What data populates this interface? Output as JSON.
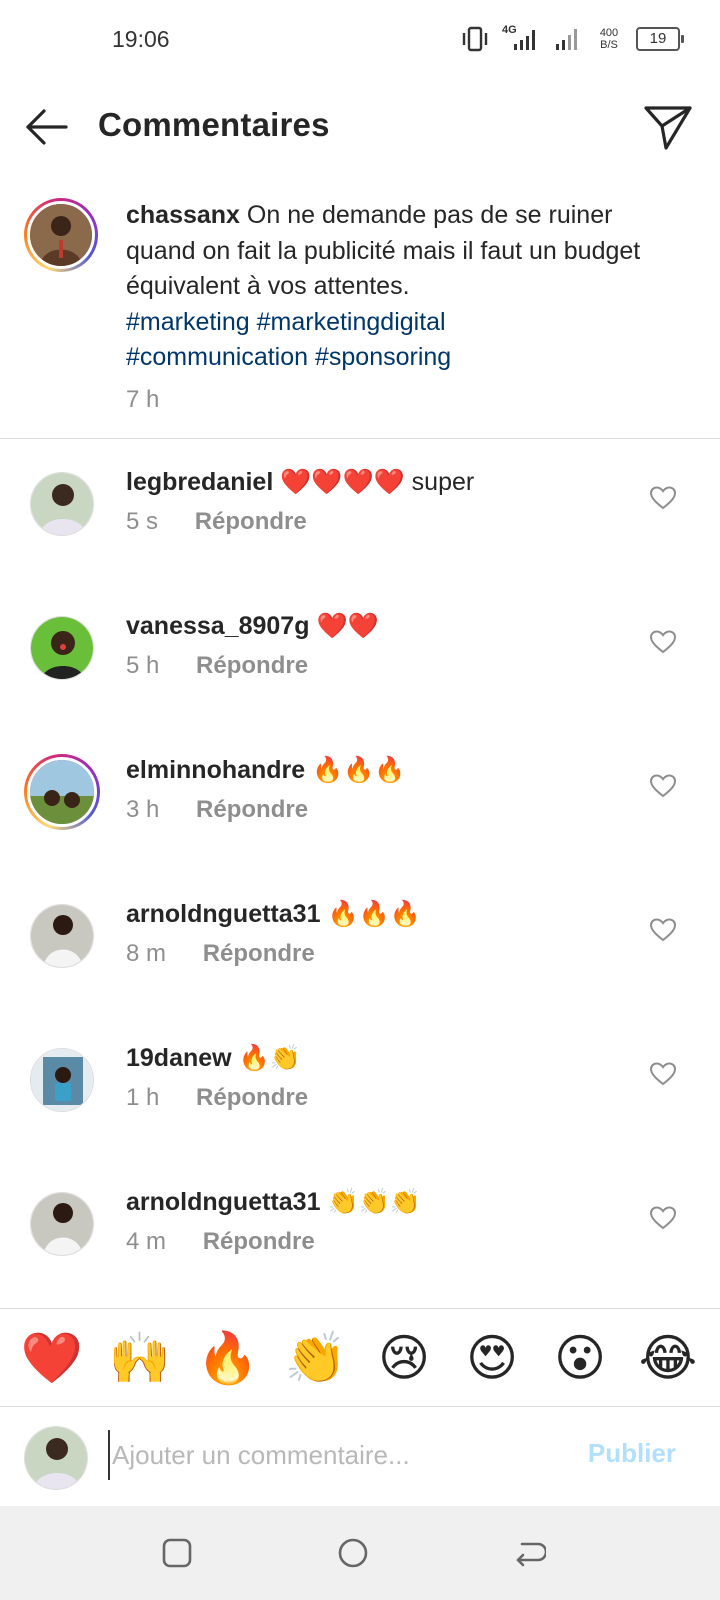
{
  "status_bar": {
    "time": "19:06",
    "network": "4G",
    "speed_top": "400",
    "speed_bottom": "B/S",
    "battery": "19"
  },
  "header": {
    "title": "Commentaires"
  },
  "caption": {
    "username": "chassanx",
    "text": "On ne demande pas de se ruiner quand on fait la publicité mais il faut un budget équivalent à vos attentes.",
    "hashtags": [
      "#marketing",
      "#marketingdigital",
      "#communication",
      "#sponsoring"
    ],
    "time": "7 h"
  },
  "comments": [
    {
      "username": "legbredaniel",
      "text": "❤️❤️❤️❤️ super",
      "time": "5 s",
      "reply": "Répondre"
    },
    {
      "username": "vanessa_8907g",
      "text": "❤️❤️",
      "time": "5 h",
      "reply": "Répondre"
    },
    {
      "username": "elminnohandre",
      "text": "🔥🔥🔥",
      "time": "3 h",
      "reply": "Répondre"
    },
    {
      "username": "arnoldnguetta31",
      "text": "🔥🔥🔥",
      "time": "8 m",
      "reply": "Répondre"
    },
    {
      "username": "19danew",
      "text": "🔥👏",
      "time": "1 h",
      "reply": "Répondre"
    },
    {
      "username": "arnoldnguetta31",
      "text": "👏👏👏",
      "time": "4 m",
      "reply": "Répondre"
    }
  ],
  "emoji_bar": [
    "❤️",
    "🙌",
    "🔥",
    "👏",
    "😢",
    "😍",
    "😮",
    "😂"
  ],
  "composer": {
    "placeholder": "Ajouter un commentaire...",
    "publish_label": "Publier"
  },
  "colors": {
    "hashtag": "#00376b",
    "secondary_text": "#8e8e8e",
    "publish_disabled": "#b2dffc"
  }
}
